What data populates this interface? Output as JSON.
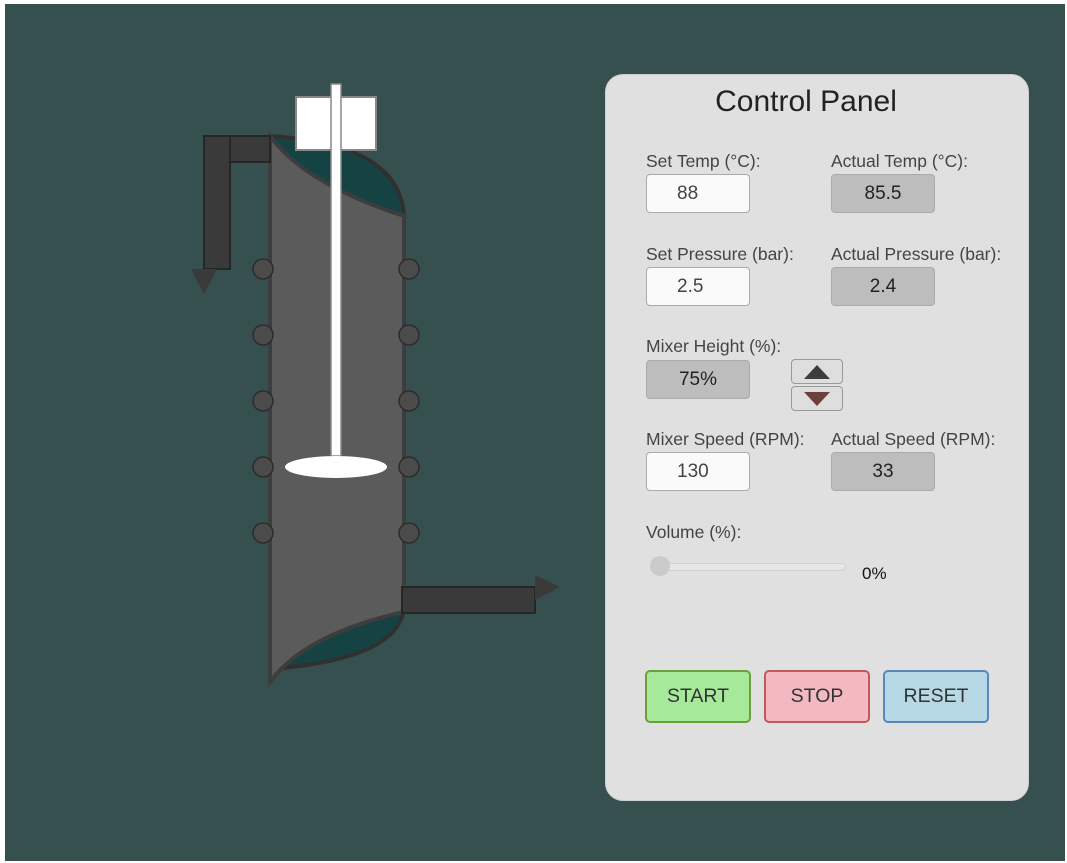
{
  "colors": {
    "background": "#364f4f",
    "vessel_body": "#5b5b5b",
    "vessel_outline": "#303030",
    "vessel_cap": "#154344",
    "pipe": "#3a3a3a",
    "panel": "#e0e0e0",
    "start_button": "#a6e99a",
    "stop_button": "#f2b9c0",
    "reset_button": "#b7d9e6"
  },
  "reactor": {
    "jacket_port_count_per_side": 5,
    "inlet_direction": "down",
    "outlet_direction": "right"
  },
  "panel": {
    "title": "Control Panel",
    "set_temp": {
      "label": "Set Temp (°C):",
      "value": "88"
    },
    "actual_temp": {
      "label": "Actual Temp (°C):",
      "value": "85.5"
    },
    "set_pressure": {
      "label": "Set Pressure (bar):",
      "value": "2.5"
    },
    "actual_pressure": {
      "label": "Actual Pressure (bar):",
      "value": "2.4"
    },
    "mixer_height": {
      "label": "Mixer Height (%):",
      "value": "75%",
      "up_icon": "triangle-up-icon",
      "down_icon": "triangle-down-icon"
    },
    "mixer_speed": {
      "label": "Mixer Speed (RPM):",
      "value": "130"
    },
    "actual_speed": {
      "label": "Actual Speed (RPM):",
      "value": "33"
    },
    "volume": {
      "label": "Volume (%):",
      "percent": 0,
      "display": "0%"
    },
    "buttons": {
      "start": "START",
      "stop": "STOP",
      "reset": "RESET"
    }
  }
}
